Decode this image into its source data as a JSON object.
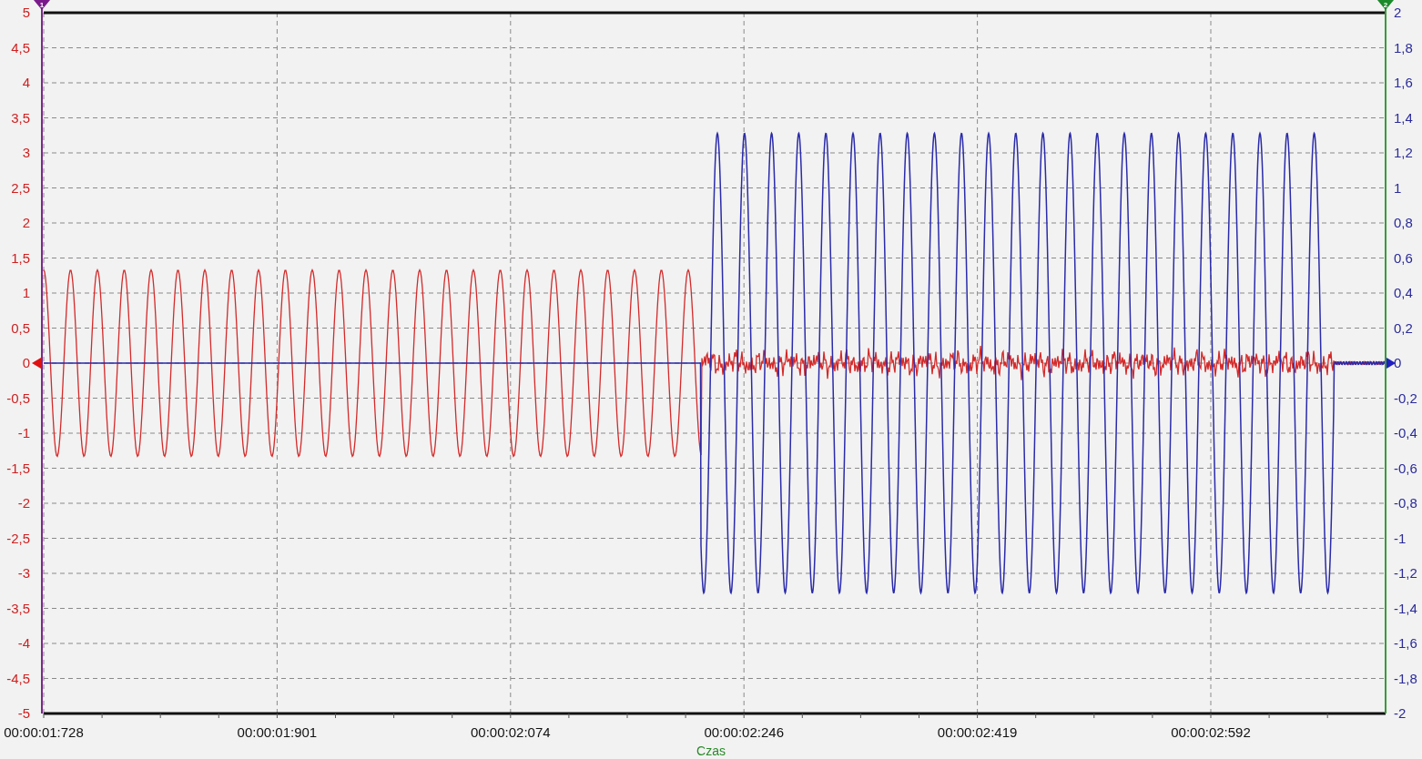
{
  "chart": {
    "channel_markers": [
      {
        "label": "1"
      },
      {
        "label": "2"
      }
    ],
    "left_axis": {
      "ticks": [
        "5",
        "4,5",
        "4",
        "3,5",
        "3",
        "2,5",
        "2",
        "1,5",
        "1",
        "0,5",
        "0",
        "-0,5",
        "-1",
        "-1,5",
        "-2",
        "-2,5",
        "-3",
        "-3,5",
        "-4",
        "-4,5",
        "-5"
      ]
    },
    "right_axis": {
      "ticks": [
        "2",
        "1,8",
        "1,6",
        "1,4",
        "1,2",
        "1",
        "0,8",
        "0,6",
        "0,4",
        "0,2",
        "0",
        "-0,2",
        "-0,4",
        "-0,6",
        "-0,8",
        "-1",
        "-1,2",
        "-1,4",
        "-1,6",
        "-1,8",
        "-2"
      ]
    },
    "x_axis": {
      "title": "Czas",
      "ticks": [
        "00:00:01:728",
        "00:00:01:901",
        "00:00:02:074",
        "00:00:02:246",
        "00:00:02:419",
        "00:00:02:592"
      ]
    }
  }
}
